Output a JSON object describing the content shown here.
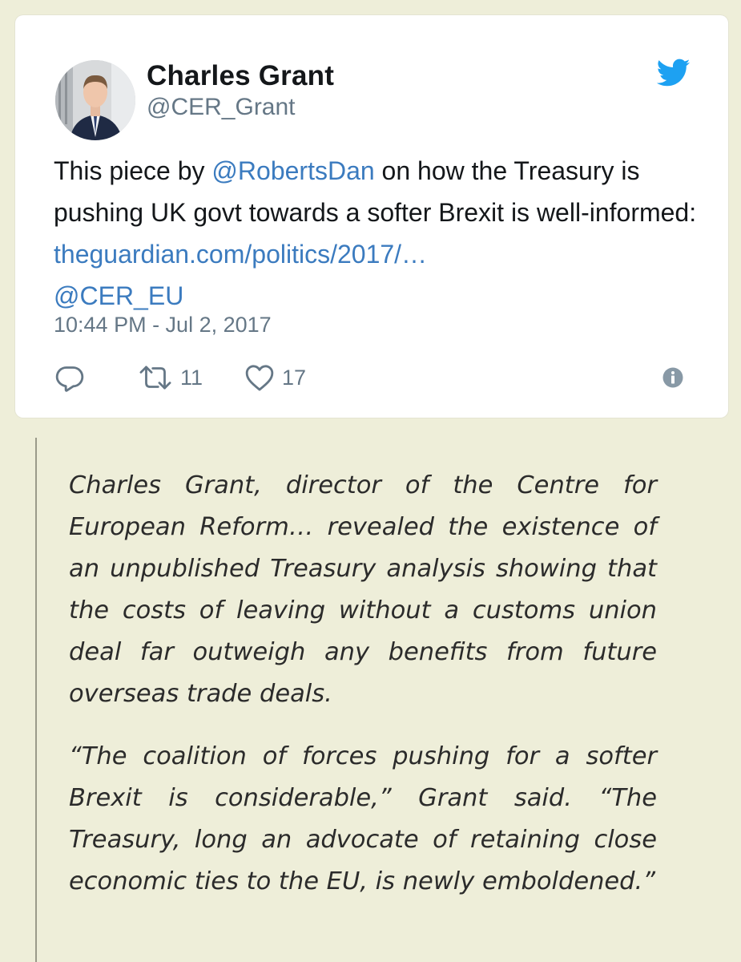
{
  "tweet": {
    "author_name": "Charles Grant",
    "author_handle": "@CER_Grant",
    "avatar_icon": "profile-photo",
    "brand_icon": "twitter-bird-icon",
    "brand_color": "#1da1f2",
    "link_color": "#3b7bbf",
    "text_part1": "This piece by ",
    "mention1": "@RobertsDan",
    "text_part2": " on how the Treasury is pushing UK govt towards a softer Brexit is well-informed: ",
    "url": "theguardian.com/politics/2017/…",
    "text_part3": " ",
    "mention2": "@CER_EU",
    "timestamp": "10:44 PM - Jul 2, 2017",
    "actions": {
      "reply_icon": "reply-icon",
      "retweet_icon": "retweet-icon",
      "retweet_count": "11",
      "like_icon": "heart-icon",
      "like_count": "17",
      "info_icon": "info-icon"
    }
  },
  "quote": {
    "paragraph1": "Charles Grant, director of the Centre for European Reform… revealed the existence of an unpublished Treasury analysis showing that the costs of leaving without a customs union deal far outweigh any benefits from future overseas trade deals.",
    "paragraph2": "“The coalition of forces pushing for a softer Brexit is considerable,” Grant said. “The Treasury, long an advocate of retaining close economic ties to the EU, is newly emboldened.”"
  }
}
